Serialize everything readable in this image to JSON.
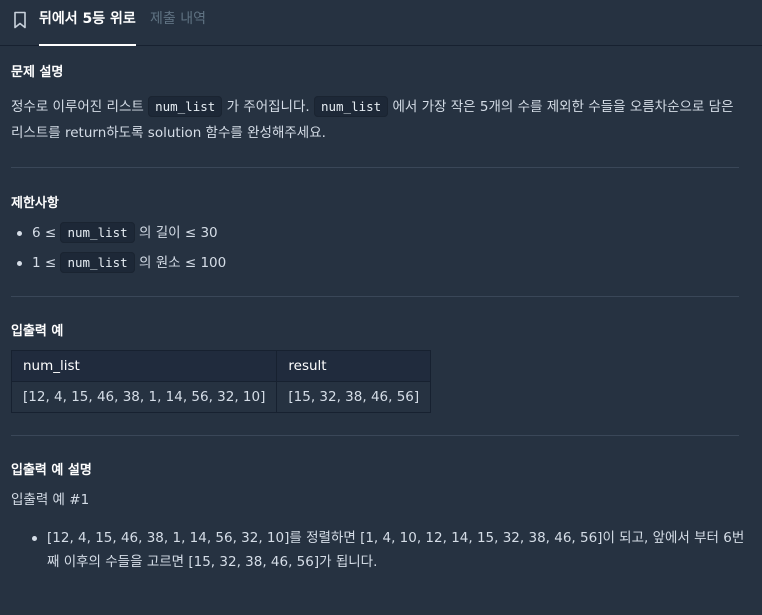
{
  "tabs": {
    "active_label": "뒤에서 5등 위로",
    "inactive_label": "제출 내역",
    "bookmark_icon": "bookmark-icon"
  },
  "problem": {
    "heading": "문제 설명",
    "text_1": "정수로 이루어진 리스트 ",
    "code_1": "num_list",
    "text_2": " 가 주어집니다. ",
    "code_2": "num_list",
    "text_3": " 에서 가장 작은 5개의 수를 제외한 수들을 오름차순으로 담은 리스트를 return하도록 solution 함수를 완성해주세요."
  },
  "constraints": {
    "heading": "제한사항",
    "items": [
      {
        "prefix": "6 ≤ ",
        "code": "num_list",
        "suffix": " 의 길이 ≤ 30"
      },
      {
        "prefix": "1 ≤ ",
        "code": "num_list",
        "suffix": " 의 원소 ≤ 100"
      }
    ]
  },
  "io_example": {
    "heading": "입출력 예",
    "columns": [
      "num_list",
      "result"
    ],
    "rows": [
      [
        "[12, 4, 15, 46, 38, 1, 14, 56, 32, 10]",
        "[15, 32, 38, 46, 56]"
      ]
    ]
  },
  "io_explanation": {
    "heading": "입출력 예 설명",
    "subheading": "입출력 예 #1",
    "bullet": "[12, 4, 15, 46, 38, 1, 14, 56, 32, 10]를 정렬하면 [1, 4, 10, 12, 14, 15, 32, 38, 46, 56]이 되고, 앞에서 부터 6번째 이후의 수들을 고르면 [15, 32, 38, 46, 56]가 됩니다."
  }
}
